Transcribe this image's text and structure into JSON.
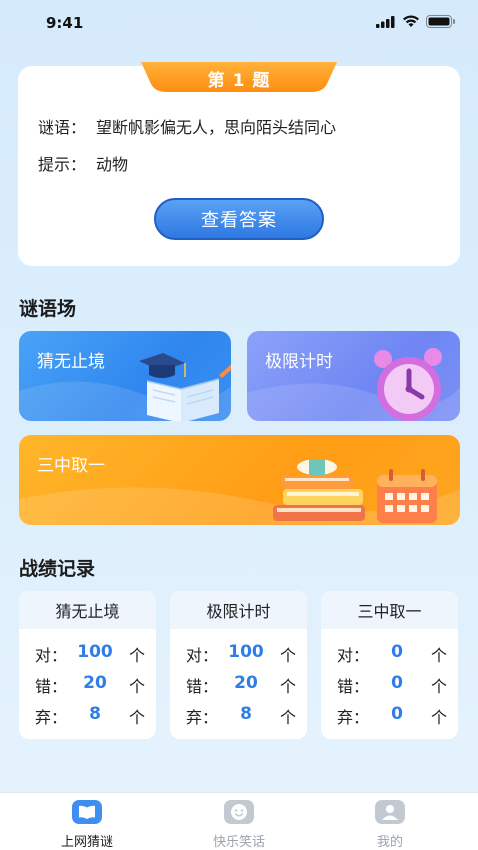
{
  "status_bar": {
    "time": "9:41",
    "icons": [
      "signal-icon",
      "wifi-icon",
      "battery-icon"
    ]
  },
  "riddle": {
    "number_label": "第 1 题",
    "riddle_key": "谜语：",
    "riddle_text": "望断帆影偏无人，思向陌头结同心",
    "hint_key": "提示：",
    "hint_text": "动物",
    "answer_button": "查看答案"
  },
  "section_games": {
    "title": "谜语场",
    "cards": [
      {
        "label": "猜无止境",
        "icon": "book-icon",
        "color": "#3a8ff0"
      },
      {
        "label": "极限计时",
        "icon": "alarm-clock-icon",
        "color": "#7c90f5"
      },
      {
        "label": "三中取一",
        "icon": "books-calendar-icon",
        "color": "#ffa620"
      }
    ]
  },
  "section_records": {
    "title": "战绩记录",
    "cards": [
      {
        "title": "猜无止境",
        "rows": [
          {
            "key": "对：",
            "value": "100",
            "unit": "个"
          },
          {
            "key": "错：",
            "value": "20",
            "unit": "个"
          },
          {
            "key": "弃：",
            "value": "8",
            "unit": "个"
          }
        ]
      },
      {
        "title": "极限计时",
        "rows": [
          {
            "key": "对：",
            "value": "100",
            "unit": "个"
          },
          {
            "key": "错：",
            "value": "20",
            "unit": "个"
          },
          {
            "key": "弃：",
            "value": "8",
            "unit": "个"
          }
        ]
      },
      {
        "title": "三中取一",
        "rows": [
          {
            "key": "对：",
            "value": "0",
            "unit": "个"
          },
          {
            "key": "错：",
            "value": "0",
            "unit": "个"
          },
          {
            "key": "弃：",
            "value": "0",
            "unit": "个"
          }
        ]
      }
    ]
  },
  "bottom_nav": {
    "items": [
      {
        "label": "上网猜谜",
        "icon": "book-icon",
        "active": true
      },
      {
        "label": "快乐笑话",
        "icon": "smile-icon",
        "active": false
      },
      {
        "label": "我的",
        "icon": "user-icon",
        "active": false
      }
    ]
  },
  "colors": {
    "accent_blue": "#2f7de6",
    "accent_orange": "#ff9d15",
    "background": "#d5eafb"
  }
}
